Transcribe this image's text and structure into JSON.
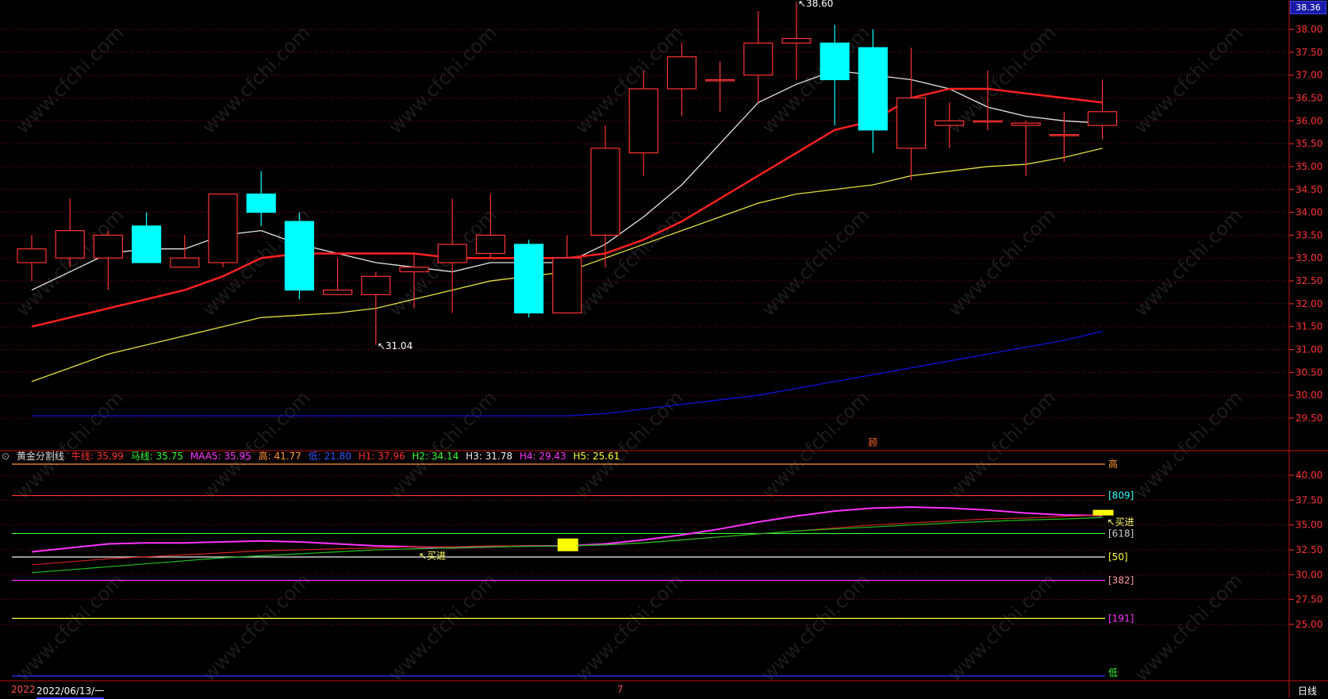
{
  "axis_top_value": "38.36",
  "indicator": {
    "name": "黄金分割线",
    "items": [
      {
        "label": "牛线: 35.99",
        "color": "#ff3333"
      },
      {
        "label": "马线: 35.75",
        "color": "#33ff33"
      },
      {
        "label": "MAA5: 35.95",
        "color": "#ff33ff"
      },
      {
        "label": "高: 41.77",
        "color": "#ff9933"
      },
      {
        "label": "低: 21.80",
        "color": "#3333ff"
      },
      {
        "label": "H1: 37.96",
        "color": "#ff3333"
      },
      {
        "label": "H2: 34.14",
        "color": "#33ff33"
      },
      {
        "label": "H3: 31.78",
        "color": "#eeeeee"
      },
      {
        "label": "H4: 29.43",
        "color": "#ff33ff"
      },
      {
        "label": "H5: 25.61",
        "color": "#ffff33"
      }
    ]
  },
  "footer": {
    "date_left": "2022",
    "date_main": "2022/06/13/一",
    "month_mark": "7",
    "period": "日线"
  },
  "colors": {
    "up": "#ff3333",
    "down": "#00ffff",
    "grid": "#8a1010",
    "axis_text": "#ff3333"
  },
  "chart_data": [
    {
      "type": "candlestick",
      "title": "",
      "ylim": [
        29.3,
        38.6
      ],
      "yticks": [
        "38.00",
        "37.50",
        "37.00",
        "36.50",
        "36.00",
        "35.50",
        "35.00",
        "34.50",
        "34.00",
        "33.50",
        "33.00",
        "32.50",
        "32.00",
        "31.50",
        "31.00",
        "30.50",
        "30.00",
        "29.50"
      ],
      "candles": [
        {
          "o": 32.9,
          "h": 33.5,
          "l": 32.5,
          "c": 33.2
        },
        {
          "o": 33.0,
          "h": 34.3,
          "l": 32.8,
          "c": 33.6
        },
        {
          "o": 33.0,
          "h": 33.6,
          "l": 32.3,
          "c": 33.5
        },
        {
          "o": 33.7,
          "h": 34.0,
          "l": 32.9,
          "c": 32.9
        },
        {
          "o": 32.8,
          "h": 33.5,
          "l": 32.8,
          "c": 33.0
        },
        {
          "o": 32.9,
          "h": 34.4,
          "l": 32.8,
          "c": 34.4
        },
        {
          "o": 34.4,
          "h": 34.9,
          "l": 33.7,
          "c": 34.0
        },
        {
          "o": 33.8,
          "h": 34.0,
          "l": 32.1,
          "c": 32.3
        },
        {
          "o": 32.2,
          "h": 33.0,
          "l": 32.2,
          "c": 32.3
        },
        {
          "o": 32.2,
          "h": 32.7,
          "l": 31.1,
          "c": 32.6
        },
        {
          "o": 32.7,
          "h": 33.1,
          "l": 31.9,
          "c": 32.8
        },
        {
          "o": 32.9,
          "h": 34.3,
          "l": 31.8,
          "c": 33.3
        },
        {
          "o": 33.1,
          "h": 34.4,
          "l": 33.0,
          "c": 33.5
        },
        {
          "o": 33.3,
          "h": 33.4,
          "l": 31.7,
          "c": 31.8
        },
        {
          "o": 31.8,
          "h": 33.5,
          "l": 31.8,
          "c": 33.0
        },
        {
          "o": 33.5,
          "h": 35.9,
          "l": 32.8,
          "c": 35.4
        },
        {
          "o": 35.3,
          "h": 37.1,
          "l": 34.8,
          "c": 36.7
        },
        {
          "o": 36.7,
          "h": 37.7,
          "l": 36.1,
          "c": 37.4
        },
        {
          "o": 36.9,
          "h": 37.3,
          "l": 36.2,
          "c": 36.9
        },
        {
          "o": 37.0,
          "h": 38.4,
          "l": 36.4,
          "c": 37.7
        },
        {
          "o": 37.7,
          "h": 38.6,
          "l": 36.9,
          "c": 37.8
        },
        {
          "o": 37.7,
          "h": 38.1,
          "l": 35.9,
          "c": 36.9
        },
        {
          "o": 37.6,
          "h": 38.0,
          "l": 35.3,
          "c": 35.8
        },
        {
          "o": 35.4,
          "h": 37.6,
          "l": 34.7,
          "c": 36.5
        },
        {
          "o": 35.9,
          "h": 36.4,
          "l": 35.4,
          "c": 36.0
        },
        {
          "o": 36.0,
          "h": 37.1,
          "l": 35.8,
          "c": 36.0
        },
        {
          "o": 35.9,
          "h": 36.0,
          "l": 34.8,
          "c": 35.95
        },
        {
          "o": 35.7,
          "h": 36.2,
          "l": 35.1,
          "c": 35.7
        },
        {
          "o": 35.9,
          "h": 36.9,
          "l": 35.6,
          "c": 36.2
        }
      ],
      "ma_series": [
        {
          "color": "#e6e6e6",
          "values": [
            32.3,
            32.7,
            33.1,
            33.2,
            33.2,
            33.5,
            33.6,
            33.3,
            33.1,
            32.9,
            32.8,
            32.7,
            32.9,
            32.9,
            32.9,
            33.3,
            33.9,
            34.6,
            35.5,
            36.4,
            36.8,
            37.1,
            37.0,
            36.9,
            36.7,
            36.3,
            36.1,
            36.0,
            35.95
          ]
        },
        {
          "color": "#ff2020",
          "values": [
            31.5,
            31.7,
            31.9,
            32.1,
            32.3,
            32.6,
            33.0,
            33.1,
            33.1,
            33.1,
            33.1,
            33.0,
            33.0,
            33.0,
            33.0,
            33.1,
            33.4,
            33.8,
            34.3,
            34.8,
            35.3,
            35.8,
            36.0,
            36.5,
            36.7,
            36.7,
            36.6,
            36.5,
            36.4
          ]
        },
        {
          "color": "#e0e040",
          "values": [
            30.3,
            30.6,
            30.9,
            31.1,
            31.3,
            31.5,
            31.7,
            31.75,
            31.8,
            31.9,
            32.1,
            32.3,
            32.5,
            32.6,
            32.7,
            33.0,
            33.3,
            33.6,
            33.9,
            34.2,
            34.4,
            34.5,
            34.6,
            34.8,
            34.9,
            35.0,
            35.05,
            35.2,
            35.4
          ]
        },
        {
          "color": "#1010dd",
          "values": [
            29.55,
            29.55,
            29.55,
            29.55,
            29.55,
            29.55,
            29.55,
            29.55,
            29.55,
            29.55,
            29.55,
            29.55,
            29.55,
            29.55,
            29.55,
            29.6,
            29.7,
            29.8,
            29.9,
            30.0,
            30.15,
            30.3,
            30.45,
            30.6,
            30.75,
            30.9,
            31.05,
            31.2,
            31.4
          ]
        }
      ],
      "annotations": [
        {
          "label": "38.60",
          "candle": 20,
          "value": 38.6,
          "arrow": "↖"
        },
        {
          "label": "31.04",
          "candle": 9,
          "value": 31.1,
          "arrow": "↖"
        },
        {
          "label": "顾",
          "candle": 22,
          "value": 29.3
        }
      ]
    },
    {
      "type": "line",
      "title": "黄金分割线",
      "ylim": [
        22.0,
        43.0
      ],
      "yticks": [
        "40.00",
        "37.50",
        "35.00",
        "32.50",
        "30.00",
        "27.50",
        "25.00"
      ],
      "levels": [
        {
          "value": 41.77,
          "color": "#ff9933",
          "label": "高"
        },
        {
          "value": 37.96,
          "color": "#ff3333",
          "label": "[809]",
          "label_color": "#33ffff"
        },
        {
          "value": 34.14,
          "color": "#33ff33",
          "label": "[618]",
          "label_color": "#cccccc"
        },
        {
          "value": 31.78,
          "color": "#eeeeee",
          "label": "[50]",
          "label_color": "#ffff33"
        },
        {
          "value": 29.43,
          "color": "#ff33ff",
          "label": "[382]",
          "label_color": "#ff9999"
        },
        {
          "value": 25.61,
          "color": "#ffff33",
          "label": "[191]",
          "label_color": "#ff33ff"
        },
        {
          "value": 21.8,
          "color": "#3333ff",
          "label": "低",
          "label_color": "#33ff33"
        }
      ],
      "series": [
        {
          "color": "#ff33ff",
          "values": [
            32.3,
            32.7,
            33.1,
            33.2,
            33.2,
            33.3,
            33.4,
            33.3,
            33.1,
            32.9,
            32.8,
            32.7,
            32.8,
            32.9,
            32.9,
            33.1,
            33.5,
            34.0,
            34.6,
            35.3,
            35.9,
            36.4,
            36.7,
            36.8,
            36.7,
            36.5,
            36.2,
            36.0,
            35.95
          ]
        },
        {
          "color": "#d02020",
          "values": [
            31.0,
            31.3,
            31.6,
            31.8,
            32.0,
            32.2,
            32.4,
            32.5,
            32.6,
            32.7,
            32.8,
            32.8,
            32.9,
            32.9,
            32.9,
            33.0,
            33.2,
            33.5,
            33.8,
            34.1,
            34.4,
            34.7,
            35.0,
            35.2,
            35.4,
            35.6,
            35.7,
            35.85,
            35.99
          ]
        },
        {
          "color": "#20c020",
          "values": [
            30.2,
            30.5,
            30.8,
            31.1,
            31.4,
            31.7,
            31.9,
            32.1,
            32.3,
            32.5,
            32.6,
            32.7,
            32.8,
            32.85,
            32.9,
            33.0,
            33.2,
            33.5,
            33.8,
            34.1,
            34.4,
            34.6,
            34.8,
            35.0,
            35.2,
            35.35,
            35.5,
            35.6,
            35.75
          ]
        }
      ],
      "signals": [
        {
          "label": "买进",
          "candle": 10,
          "value": 32.7
        },
        {
          "label": "买进",
          "candle": 28,
          "value": 36.1
        }
      ]
    }
  ]
}
